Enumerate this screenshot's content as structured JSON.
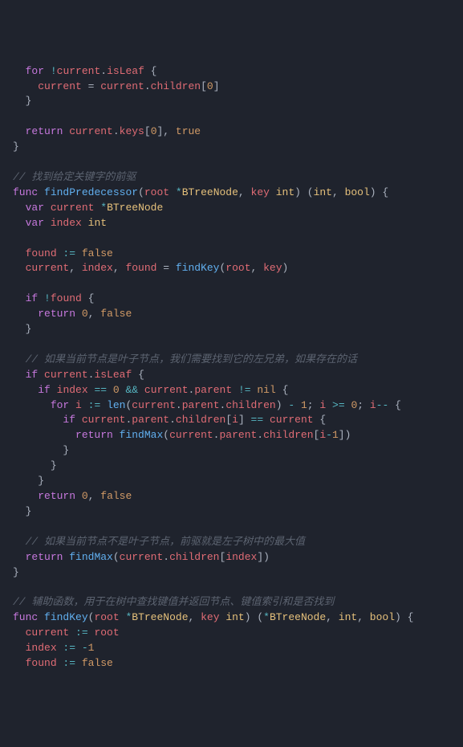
{
  "code": {
    "line1": {
      "kw_for": "for",
      "bang": "!",
      "cur": "current",
      "dot": ".",
      "isLeaf": "isLeaf",
      "lb": " {"
    },
    "line2": {
      "cur": "current",
      "eq": " = ",
      "cur2": "current",
      "dot": ".",
      "children": "children",
      "lb": "[",
      "zero": "0",
      "rb": "]"
    },
    "line3": {
      "rb": "}"
    },
    "line4": "",
    "line5": {
      "ret": "return",
      "sp": " ",
      "cur": "current",
      "dot": ".",
      "keys": "keys",
      "lb": "[",
      "zero": "0",
      "rb": "], ",
      "tru": "true"
    },
    "line6": {
      "rb": "}"
    },
    "line7": "",
    "line8": {
      "cmt": "// 找到给定关键字的前驱"
    },
    "line9": {
      "func": "func",
      "sp": " ",
      "fn": "findPredecessor",
      "lp": "(",
      "root": "root ",
      "star": "*",
      "ty": "BTreeNode",
      "c": ", ",
      "key": "key ",
      "int": "int",
      "rp": ") (",
      "int2": "int",
      "c2": ", ",
      "bool": "bool",
      "rp2": ") {"
    },
    "line10": {
      "var": "var",
      "sp": " ",
      "cur": "current ",
      "star": "*",
      "ty": "BTreeNode"
    },
    "line11": {
      "var": "var",
      "sp": " ",
      "idx": "index ",
      "int": "int"
    },
    "line12": "",
    "line13": {
      "found": "found ",
      ":=": ":=",
      "sp": " ",
      "false": "false"
    },
    "line14": {
      "cur": "current",
      "c1": ", ",
      "idx": "index",
      "c2": ", ",
      "found": "found",
      "eq": " = ",
      "fn": "findKey",
      "lp": "(",
      "root": "root",
      "c3": ", ",
      "key": "key",
      "rp": ")"
    },
    "line15": "",
    "line16": {
      "if": "if",
      "sp": " ",
      "bang": "!",
      "found": "found",
      "lb": " {"
    },
    "line17": {
      "ret": "return",
      "sp": " ",
      "zero": "0",
      "c": ", ",
      "false": "false"
    },
    "line18": {
      "rb": "}"
    },
    "line19": "",
    "line20": {
      "cmt": "// 如果当前节点是叶子节点，我们需要找到它的左兄弟，如果存在的话"
    },
    "line21": {
      "if": "if",
      "sp": " ",
      "cur": "current",
      "dot": ".",
      "isLeaf": "isLeaf",
      "lb": " {"
    },
    "line22": {
      "if": "if",
      "sp": " ",
      "idx": "index",
      "eq": " == ",
      "zero": "0",
      "sp2": " ",
      "amp": "&&",
      "sp3": " ",
      "cur": "current",
      "dot": ".",
      "parent": "parent",
      "neq": " != ",
      "nil": "nil",
      "lb": " {"
    },
    "line23": {
      "for": "for",
      "sp": " ",
      "i": "i ",
      ":=": ":=",
      "sp2": " ",
      "len": "len",
      "lp": "(",
      "cur": "current",
      "dot": ".",
      "parent": "parent",
      "dot2": ".",
      "children": "children",
      "rp": ") ",
      "minus": "-",
      "sp3": " ",
      "one": "1",
      "sc": "; ",
      "i2": "i",
      "ge": " >= ",
      "zero": "0",
      "sc2": "; ",
      "i3": "i",
      "dec": "--",
      "lb": " {"
    },
    "line24": {
      "if": "if",
      "sp": " ",
      "cur": "current",
      "dot": ".",
      "parent": "parent",
      "dot2": ".",
      "children": "children",
      "lb": "[",
      "i": "i",
      "rb": "] ",
      "eq": "==",
      "sp2": " ",
      "cur2": "current",
      "lb2": " {"
    },
    "line25": {
      "ret": "return",
      "sp": " ",
      "fn": "findMax",
      "lp": "(",
      "cur": "current",
      "dot": ".",
      "parent": "parent",
      "dot2": ".",
      "children": "children",
      "lb": "[",
      "i": "i",
      "minus": "-",
      "one": "1",
      "rb": "])"
    },
    "line26": {
      "rb": "}"
    },
    "line27": {
      "rb": "}"
    },
    "line28": {
      "rb": "}"
    },
    "line29": {
      "ret": "return",
      "sp": " ",
      "zero": "0",
      "c": ", ",
      "false": "false"
    },
    "line30": {
      "rb": "}"
    },
    "line31": "",
    "line32": {
      "cmt": "// 如果当前节点不是叶子节点，前驱就是左子树中的最大值"
    },
    "line33": {
      "ret": "return",
      "sp": " ",
      "fn": "findMax",
      "lp": "(",
      "cur": "current",
      "dot": ".",
      "children": "children",
      "lb": "[",
      "idx": "index",
      "rb": "])"
    },
    "line34": {
      "rb": "}"
    },
    "line35": "",
    "line36": {
      "cmt": "// 辅助函数，用于在树中查找键值并返回节点、键值索引和是否找到"
    },
    "line37": {
      "func": "func",
      "sp": " ",
      "fn": "findKey",
      "lp": "(",
      "root": "root ",
      "star": "*",
      "ty": "BTreeNode",
      "c": ", ",
      "key": "key ",
      "int": "int",
      "rp": ") (",
      "star2": "*",
      "ty2": "BTreeNode",
      "c2": ", ",
      "int2": "int",
      "c3": ", ",
      "bool": "bool",
      "rp2": ") {"
    },
    "line38": {
      "cur": "current ",
      ":=": ":=",
      "sp": " ",
      "root": "root"
    },
    "line39": {
      "idx": "index ",
      ":=": ":=",
      "sp": " ",
      "minus": "-",
      "one": "1"
    },
    "line40": {
      "found": "found ",
      ":=": ":=",
      "sp": " ",
      "false": "false"
    }
  }
}
